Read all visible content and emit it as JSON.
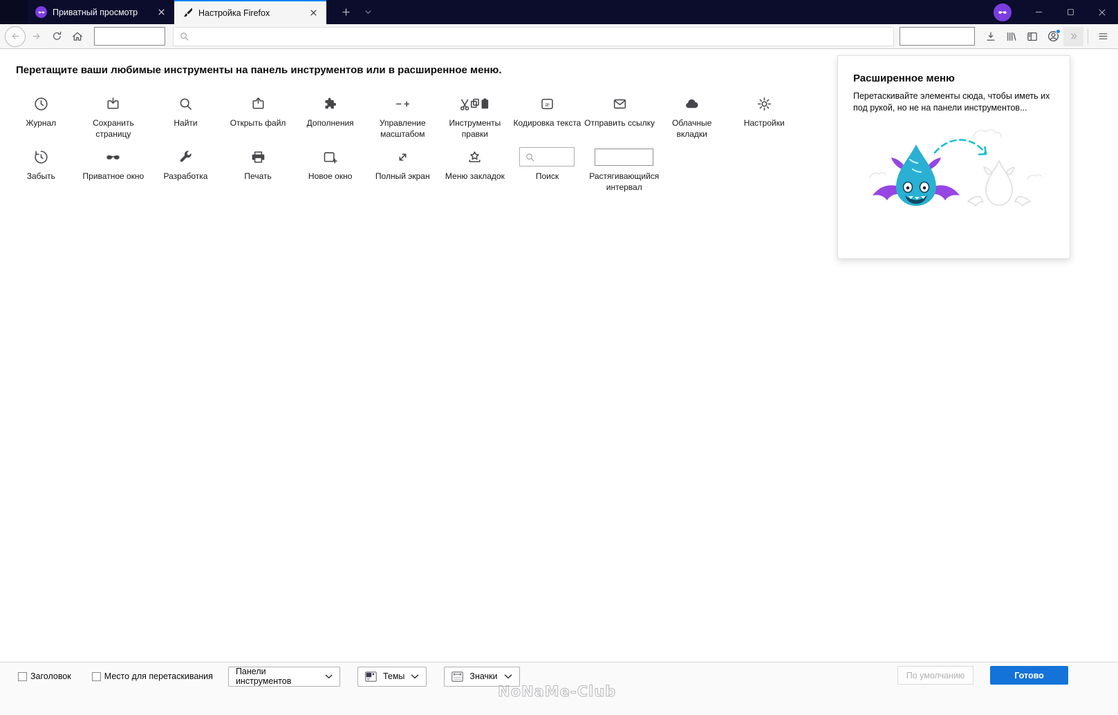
{
  "tabbar": {
    "tabs": [
      {
        "label": "Приватный просмотр"
      },
      {
        "label": "Настройка Firefox"
      }
    ]
  },
  "main": {
    "heading": "Перетащите ваши любимые инструменты на панель инструментов или в расширенное меню.",
    "row1": [
      {
        "label": "Журнал"
      },
      {
        "label": "Сохранить страницу"
      },
      {
        "label": "Найти"
      },
      {
        "label": "Открыть файл"
      },
      {
        "label": "Дополнения"
      },
      {
        "label": "Управление масштабом"
      },
      {
        "label": "Инструменты правки"
      },
      {
        "label": "Кодировка текста"
      },
      {
        "label": "Отправить ссылку"
      },
      {
        "label": "Облачные вкладки"
      },
      {
        "label": "Настройки"
      }
    ],
    "row2": [
      {
        "label": "Забыть"
      },
      {
        "label": "Приватное окно"
      },
      {
        "label": "Разработка"
      },
      {
        "label": "Печать"
      },
      {
        "label": "Новое окно"
      },
      {
        "label": "Полный экран"
      },
      {
        "label": "Меню закладок"
      },
      {
        "label": "Поиск"
      },
      {
        "label": "Растягивающийся интервал"
      }
    ]
  },
  "overflow_panel": {
    "title": "Расширенное меню",
    "description": "Перетаскивайте элементы сюда, чтобы иметь их под рукой, но не на панели инструментов..."
  },
  "footer": {
    "titlebar_checkbox": "Заголовок",
    "dragspace_checkbox": "Место для перетаскивания",
    "toolbars_dropdown": "Панели инструментов",
    "themes_dropdown": "Темы",
    "density_dropdown": "Значки",
    "watermark": "NoNaMe-Club",
    "defaults_button": "По умолчанию",
    "done_button": "Готово"
  },
  "colors": {
    "accent_blue": "#0a84ff",
    "private_purple": "#7a3de0",
    "done_button_blue": "#1373d9",
    "tabbar_dark": "#0c0c2c"
  }
}
